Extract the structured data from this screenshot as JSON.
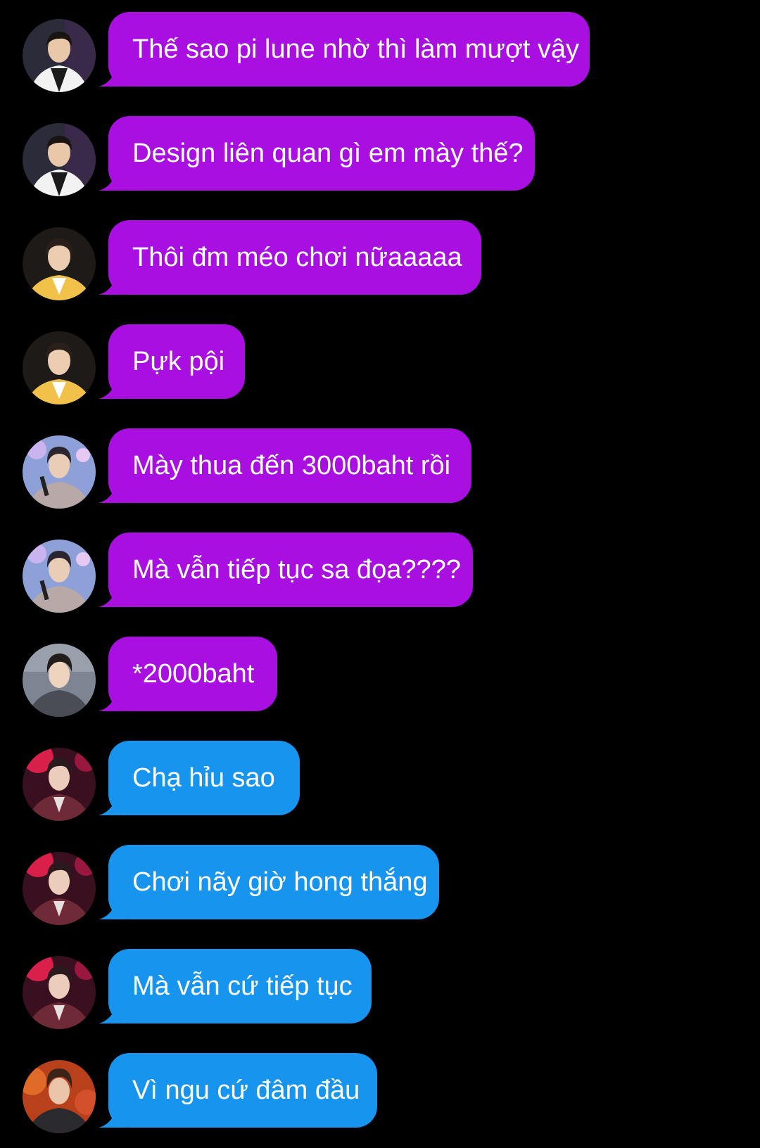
{
  "colors": {
    "background": "#000000",
    "bubble_purple": "#A80FE0",
    "bubble_blue": "#1794EE",
    "text": "#FFFFFF"
  },
  "messages": [
    {
      "text": "Thế sao pi lune nhờ thì làm mượt vậy",
      "color": "purple",
      "avatar": "avatar-white-shirt"
    },
    {
      "text": "Design liên quan gì em mày thế?",
      "color": "purple",
      "avatar": "avatar-white-shirt"
    },
    {
      "text": "Thôi đm méo chơi nữaaaaa",
      "color": "purple",
      "avatar": "avatar-yellow-jacket"
    },
    {
      "text": "Pựk pội",
      "color": "purple",
      "avatar": "avatar-yellow-jacket"
    },
    {
      "text": "Mày thua đến 3000baht rồi",
      "color": "purple",
      "avatar": "avatar-stage-mic"
    },
    {
      "text": "Mà vẫn tiếp tục sa đọa????",
      "color": "purple",
      "avatar": "avatar-stage-mic"
    },
    {
      "text": "*2000baht",
      "color": "purple",
      "avatar": "avatar-gray-jacket"
    },
    {
      "text": "Chạ hỉu sao",
      "color": "blue",
      "avatar": "avatar-red-stage"
    },
    {
      "text": "Chơi nãy giờ hong thắng",
      "color": "blue",
      "avatar": "avatar-red-stage"
    },
    {
      "text": "Mà vẫn cứ tiếp tục",
      "color": "blue",
      "avatar": "avatar-red-stage"
    },
    {
      "text": "Vì ngu cứ đâm đầu",
      "color": "blue",
      "avatar": "avatar-orange-stage"
    }
  ]
}
